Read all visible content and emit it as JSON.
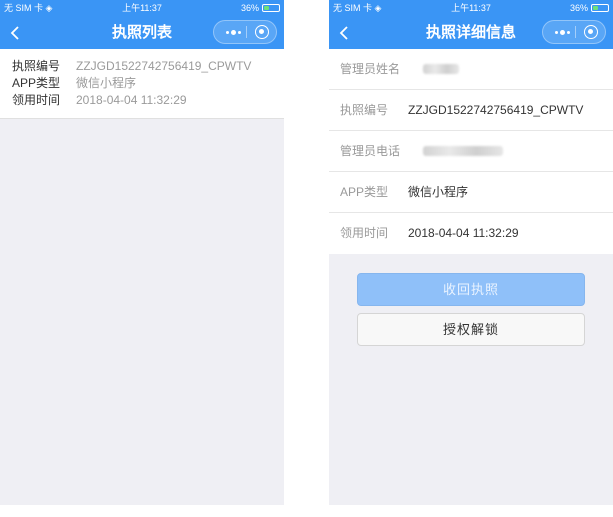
{
  "status_bar": {
    "carrier": "无 SIM 卡",
    "time": "上午11:37",
    "battery": "36%",
    "battery_level": 0.36
  },
  "colors": {
    "brand": "#3a95f5",
    "primary_button": "#8fc0f9",
    "page_bg": "#efeff4"
  },
  "left_page": {
    "title": "执照列表",
    "item": {
      "rows": [
        {
          "label": "执照编号",
          "value": "ZZJGD1522742756419_CPWTV"
        },
        {
          "label": "APP类型",
          "value": "微信小程序"
        },
        {
          "label": "领用时间",
          "value": "2018-04-04 11:32:29"
        }
      ]
    }
  },
  "right_page": {
    "title": "执照详细信息",
    "fields": [
      {
        "label": "管理员姓名",
        "value": ""
      },
      {
        "label": "执照编号",
        "value": "ZZJGD1522742756419_CPWTV"
      },
      {
        "label": "管理员电话",
        "value": ""
      },
      {
        "label": "APP类型",
        "value": "微信小程序"
      },
      {
        "label": "领用时间",
        "value": "2018-04-04 11:32:29"
      }
    ],
    "buttons": {
      "revoke": "收回执照",
      "unlock": "授权解锁"
    }
  }
}
